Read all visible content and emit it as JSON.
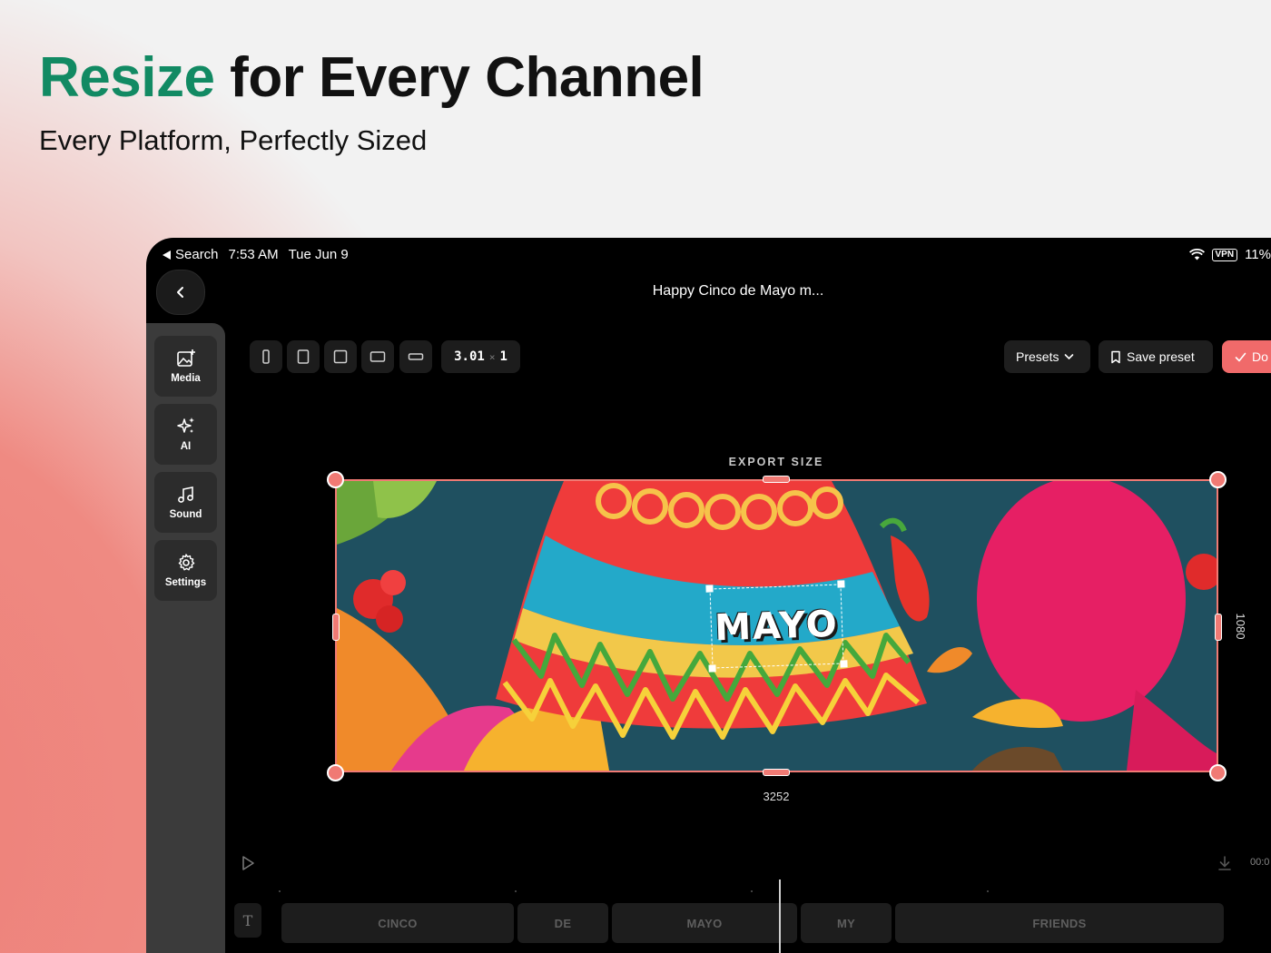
{
  "marketing": {
    "headline_accent": "Resize",
    "headline_rest": " for Every Channel",
    "subheadline": "Every Platform, Perfectly Sized",
    "accent_color": "#128a63"
  },
  "statusbar": {
    "back_app": "Search",
    "time": "7:53 AM",
    "date": "Tue Jun 9",
    "vpn": "VPN",
    "battery": "11%"
  },
  "header": {
    "title": "Happy Cinco de Mayo m..."
  },
  "sidebar": {
    "items": [
      {
        "label": "Media",
        "icon": "media-add-icon"
      },
      {
        "label": "AI",
        "icon": "sparkles-icon"
      },
      {
        "label": "Sound",
        "icon": "music-note-icon"
      },
      {
        "label": "Settings",
        "icon": "gear-icon"
      }
    ]
  },
  "toolbar": {
    "aspect_ratio": {
      "width": "3.01",
      "separator": "×",
      "height": "1"
    },
    "presets_label": "Presets",
    "save_preset_label": "Save preset",
    "done_label": "Do"
  },
  "canvas": {
    "export_label": "EXPORT SIZE",
    "width_px": "3252",
    "height_px": "1080",
    "text_overlay": "MAYO",
    "accent_color": "#f07a74"
  },
  "timeline": {
    "time": "00:0",
    "clips": [
      {
        "label": "CINCO"
      },
      {
        "label": "DE"
      },
      {
        "label": "MAYO"
      },
      {
        "label": "MY"
      },
      {
        "label": "FRIENDS"
      }
    ],
    "track_icon": "T"
  }
}
